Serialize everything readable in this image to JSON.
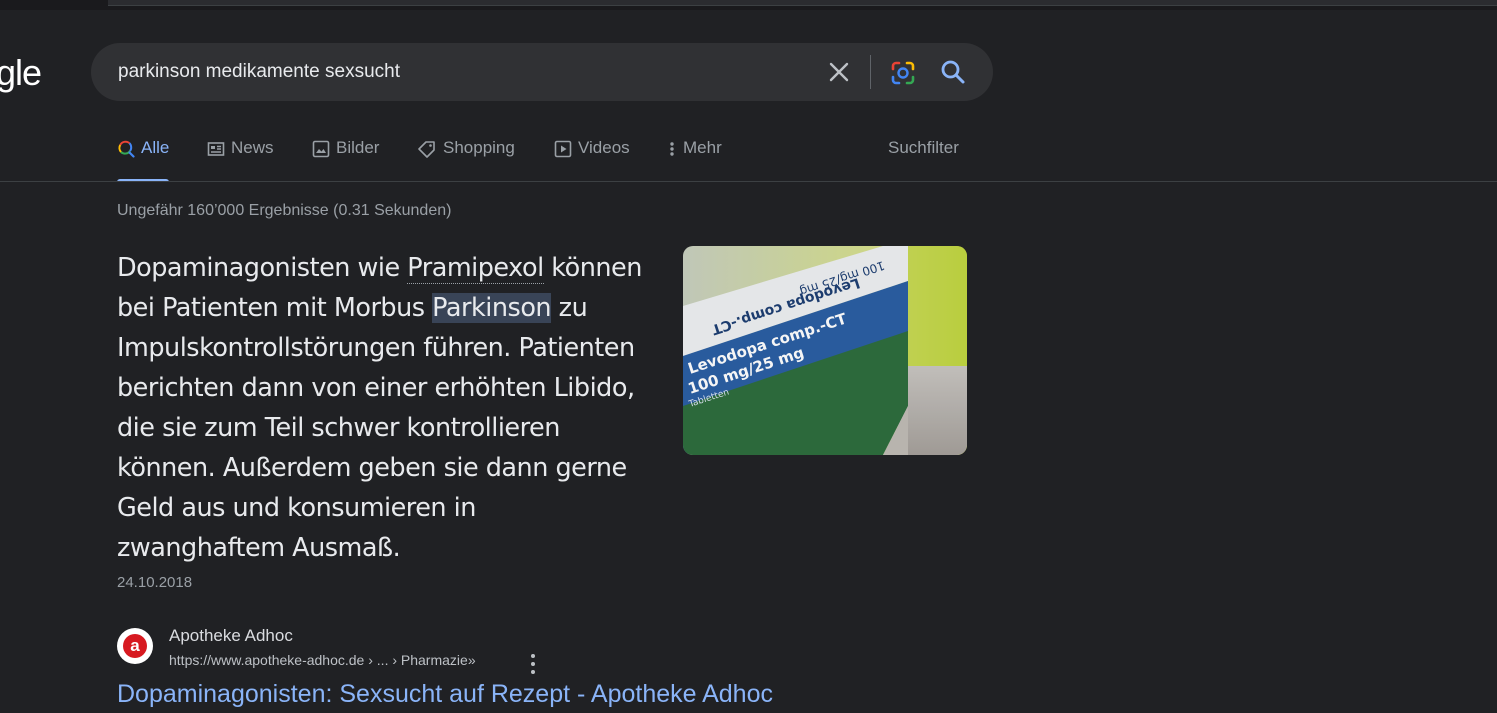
{
  "logo_text": "gle",
  "search": {
    "query": "parkinson medikamente sexsucht"
  },
  "tabs": [
    {
      "label": "Alle",
      "icon": "search-multicolor-icon",
      "active": true
    },
    {
      "label": "News",
      "icon": "newspaper-icon",
      "active": false
    },
    {
      "label": "Bilder",
      "icon": "image-icon",
      "active": false
    },
    {
      "label": "Shopping",
      "icon": "tag-icon",
      "active": false
    },
    {
      "label": "Videos",
      "icon": "play-icon",
      "active": false
    },
    {
      "label": "Mehr",
      "icon": "more-vert-icon",
      "active": false
    }
  ],
  "tools_label": "Suchfilter",
  "result_stats": "Ungefähr 160’000 Ergebnisse (0.31 Sekunden)",
  "featured_snippet": {
    "text_part1": "Dopaminagonisten wie ",
    "term_pramipexol": "Pramipexol",
    "text_part2": " können bei Patienten mit Morbus ",
    "term_parkinson": "Parkinson",
    "text_part3": " zu Impulskontrollstörungen führen. Patienten berichten dann von einer erhöhten Libido, die sie zum Teil schwer kontrollieren können. Außerdem geben sie dann gerne Geld aus und konsumieren in zwanghaftem Ausmaß.",
    "date": "24.10.2018",
    "image": {
      "line1": "Levodopa comp.-CT",
      "line2": "100 mg/25 mg",
      "line3": "Tabletten",
      "mirrored_line1": "Levodopa comp.-CT",
      "mirrored_line2": "100 mg/25 mg"
    }
  },
  "source": {
    "favicon_letter": "a",
    "name": "Apotheke Adhoc",
    "url": "https://www.apotheke-adhoc.de › ... › Pharmazie»",
    "title": "Dopaminagonisten: Sexsucht auf Rezept - Apotheke Adhoc"
  },
  "colors": {
    "background": "#202124",
    "link": "#8ab4f8",
    "search_box": "#303134",
    "highlight": "#394457"
  }
}
